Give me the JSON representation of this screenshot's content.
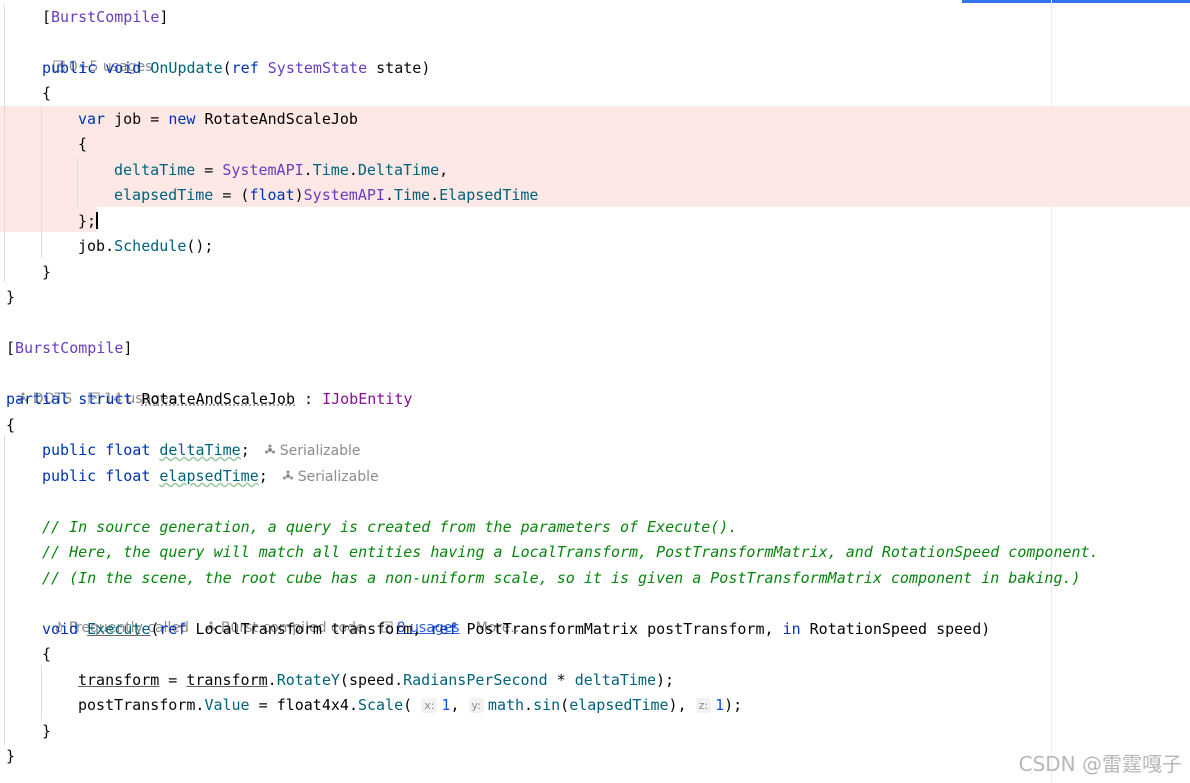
{
  "hints": {
    "usages_0_5": "0+5 usages",
    "dots": "DOTS",
    "usages_14": "14 usages",
    "serializable": "Serializable",
    "frequently_called": "Frequently called",
    "burst_compiled": "Burst compiled code",
    "usages_8": "8 usages",
    "more": "More..."
  },
  "code": {
    "burst_attr": "BurstCompile",
    "public": "public",
    "void": "void",
    "on_update": "OnUpdate",
    "ref": "ref",
    "system_state": "SystemState",
    "state": "state",
    "var": "var",
    "job": "job",
    "new": "new",
    "job_type": "RotateAndScaleJob",
    "delta_time": "deltaTime",
    "system_api": "SystemAPI",
    "time": "Time",
    "delta_time_prop": "DeltaTime",
    "elapsed_time": "elapsedTime",
    "float": "float",
    "elapsed_time_prop": "ElapsedTime",
    "schedule": "Schedule",
    "partial": "partial",
    "struct": "struct",
    "ijob_entity": "IJobEntity",
    "comment1": "// In source generation, a query is created from the parameters of Execute().",
    "comment2": "// Here, the query will match all entities having a LocalTransform, PostTransformMatrix, and RotationSpeed component.",
    "comment3": "// (In the scene, the root cube has a non-uniform scale, so it is given a PostTransformMatrix component in baking.)",
    "execute": "Execute",
    "local_transform": "LocalTransform",
    "transform": "transform",
    "post_transform_matrix": "PostTransformMatrix",
    "post_transform": "postTransform",
    "in": "in",
    "rotation_speed": "RotationSpeed",
    "speed": "speed",
    "rotate_y": "RotateY",
    "radians_per_second": "RadiansPerSecond",
    "value": "Value",
    "float4x4": "float4x4",
    "scale": "Scale",
    "math": "math",
    "sin": "sin",
    "one": "1",
    "hint_x": "x:",
    "hint_y": "y:",
    "hint_z": "z:"
  },
  "watermark": "CSDN @雷霆嘎子"
}
